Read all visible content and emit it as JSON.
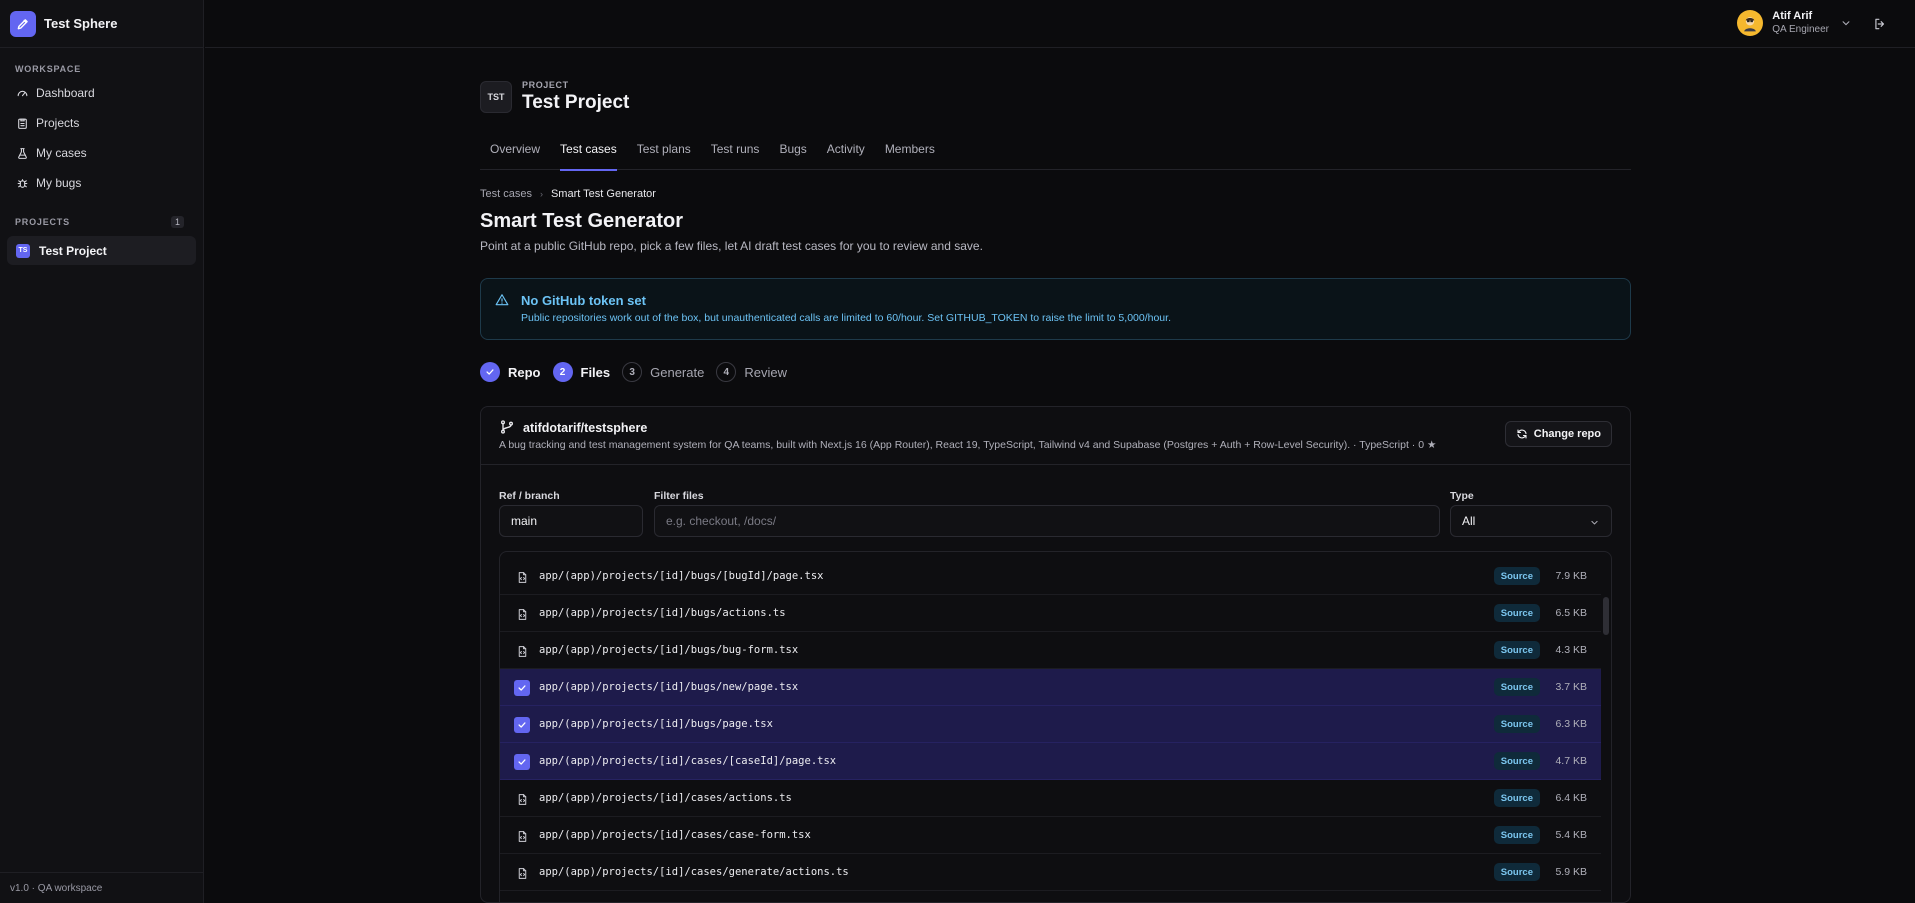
{
  "app": {
    "name": "Test Sphere"
  },
  "sidebar": {
    "workspace_label": "WORKSPACE",
    "items": [
      {
        "label": "Dashboard",
        "icon": "gauge-icon"
      },
      {
        "label": "Projects",
        "icon": "clipboard-icon"
      },
      {
        "label": "My cases",
        "icon": "flask-icon"
      },
      {
        "label": "My bugs",
        "icon": "bug-icon"
      }
    ],
    "projects_label": "PROJECTS",
    "projects_count": "1",
    "projects": [
      {
        "badge": "TS",
        "label": "Test Project"
      }
    ],
    "footer": "v1.0 · QA workspace"
  },
  "user": {
    "name": "Atif Arif",
    "role": "QA Engineer"
  },
  "project": {
    "code": "TST",
    "kicker": "PROJECT",
    "title": "Test Project"
  },
  "tabs": [
    {
      "label": "Overview"
    },
    {
      "label": "Test cases",
      "active": true
    },
    {
      "label": "Test plans"
    },
    {
      "label": "Test runs"
    },
    {
      "label": "Bugs"
    },
    {
      "label": "Activity"
    },
    {
      "label": "Members"
    }
  ],
  "breadcrumb": {
    "parent": "Test cases",
    "current": "Smart Test Generator"
  },
  "page": {
    "title": "Smart Test Generator",
    "description": "Point at a public GitHub repo, pick a few files, let AI draft test cases for you to review and save."
  },
  "alert": {
    "title": "No GitHub token set",
    "text": "Public repositories work out of the box, but unauthenticated calls are limited to 60/hour. Set GITHUB_TOKEN to raise the limit to 5,000/hour."
  },
  "steps": [
    {
      "number": "1",
      "label": "Repo",
      "state": "done"
    },
    {
      "number": "2",
      "label": "Files",
      "state": "current"
    },
    {
      "number": "3",
      "label": "Generate",
      "state": "todo"
    },
    {
      "number": "4",
      "label": "Review",
      "state": "todo"
    }
  ],
  "repo": {
    "name": "atifdotarif/testsphere",
    "description": "A bug tracking and test management system for QA teams, built with Next.js 16 (App Router), React 19, TypeScript, Tailwind v4 and Supabase (Postgres + Auth + Row-Level Security). · TypeScript · 0 ★",
    "change_label": "Change repo"
  },
  "filters": {
    "ref_label": "Ref / branch",
    "ref_value": "main",
    "filter_label": "Filter files",
    "filter_placeholder": "e.g. checkout, /docs/",
    "type_label": "Type",
    "type_value": "All"
  },
  "files": [
    {
      "path": "app/(app)/projects/[id]/bugs/[bugId]/page.tsx",
      "type": "Source",
      "size": "7.9 KB",
      "selected": false
    },
    {
      "path": "app/(app)/projects/[id]/bugs/actions.ts",
      "type": "Source",
      "size": "6.5 KB",
      "selected": false
    },
    {
      "path": "app/(app)/projects/[id]/bugs/bug-form.tsx",
      "type": "Source",
      "size": "4.3 KB",
      "selected": false
    },
    {
      "path": "app/(app)/projects/[id]/bugs/new/page.tsx",
      "type": "Source",
      "size": "3.7 KB",
      "selected": true
    },
    {
      "path": "app/(app)/projects/[id]/bugs/page.tsx",
      "type": "Source",
      "size": "6.3 KB",
      "selected": true
    },
    {
      "path": "app/(app)/projects/[id]/cases/[caseId]/page.tsx",
      "type": "Source",
      "size": "4.7 KB",
      "selected": true
    },
    {
      "path": "app/(app)/projects/[id]/cases/actions.ts",
      "type": "Source",
      "size": "6.4 KB",
      "selected": false
    },
    {
      "path": "app/(app)/projects/[id]/cases/case-form.tsx",
      "type": "Source",
      "size": "5.4 KB",
      "selected": false
    },
    {
      "path": "app/(app)/projects/[id]/cases/generate/actions.ts",
      "type": "Source",
      "size": "5.9 KB",
      "selected": false
    }
  ],
  "colors": {
    "accent": "#6366f1",
    "info": "#6cc3f5",
    "selected_row": "#1e1b4b"
  }
}
